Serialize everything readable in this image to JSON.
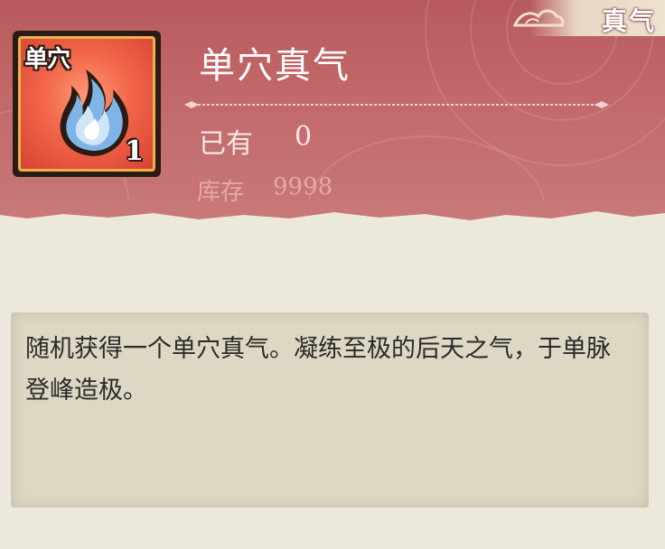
{
  "category_tag": "真气",
  "item": {
    "icon_label": "单穴",
    "icon_count": "1",
    "icon_name": "blue-flame-icon",
    "title": "单穴真气",
    "owned_label": "已有",
    "owned_value": "0",
    "stock_label": "库存",
    "stock_value": "9998"
  },
  "description": "随机获得一个单穴真气。凝练至极的后天之气，于单脉登峰造极。",
  "colors": {
    "banner": "#c2696a",
    "panel": "#ece8db",
    "desc_box": "#ddd7c4",
    "icon_frame": "#e9b34a"
  }
}
